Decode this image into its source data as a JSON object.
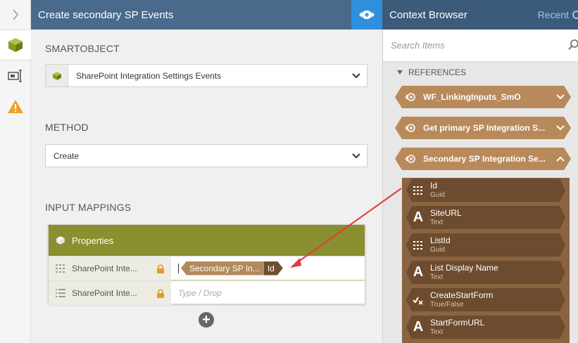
{
  "header": {
    "left_title": "Create secondary SP Events",
    "right_title": "Context Browser",
    "recent_label": "Recent"
  },
  "smartobject": {
    "section_label": "SMARTOBJECT",
    "selected": "SharePoint Integration Settings Events"
  },
  "method": {
    "section_label": "METHOD",
    "selected": "Create"
  },
  "input_mappings": {
    "section_label": "INPUT MAPPINGS",
    "panel_title": "Properties",
    "rows": [
      {
        "name": "SharePoint Inte...",
        "token_source": "Secondary SP In...",
        "token_field": "Id"
      },
      {
        "name": "SharePoint Inte...",
        "placeholder": "Type / Drop"
      }
    ]
  },
  "context_browser": {
    "search_placeholder": "Search Items",
    "references_label": "REFERENCES",
    "references": [
      {
        "label": "WF_LinkingInputs_SmO",
        "expanded": false
      },
      {
        "label": "Get primary SP Integration S...",
        "expanded": false
      },
      {
        "label": "Secondary SP Integration Se...",
        "expanded": true
      }
    ],
    "properties": [
      {
        "name": "Id",
        "type": "Guid",
        "icon": "grid-icon"
      },
      {
        "name": "SiteURL",
        "type": "Text",
        "icon": "text-icon"
      },
      {
        "name": "ListId",
        "type": "Guid",
        "icon": "grid-icon"
      },
      {
        "name": "List Display Name",
        "type": "Text",
        "icon": "text-icon"
      },
      {
        "name": "CreateStartForm",
        "type": "True/False",
        "icon": "boolean-icon"
      },
      {
        "name": "StartFormURL",
        "type": "Text",
        "icon": "text-icon"
      }
    ]
  },
  "colors": {
    "header_left": "#496a8b",
    "header_right": "#3c5a7a",
    "toggle": "#2f8fdd",
    "mapping_head": "#8a8f2f",
    "reference": "#b8895a",
    "property": "#6d4b2e",
    "arrow": "#e03c3c"
  }
}
